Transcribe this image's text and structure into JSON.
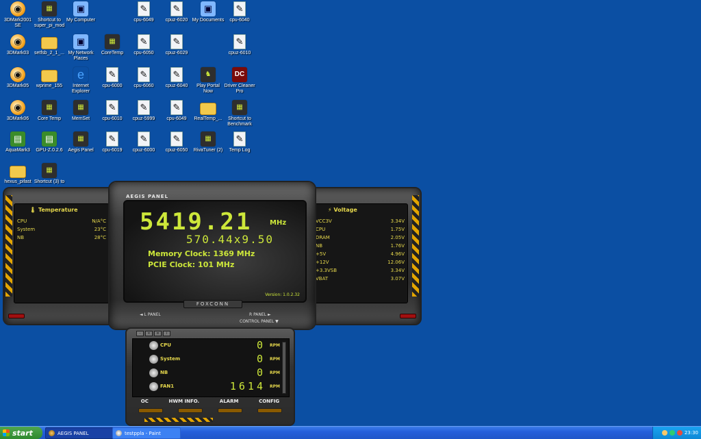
{
  "desktop": {
    "icons": [
      {
        "label": "3DMark2001 SE",
        "icon": "3dmark-icon"
      },
      {
        "label": "Shortcut to super_pi_mod",
        "icon": "superpi-icon"
      },
      {
        "label": "My Computer",
        "icon": "computer-icon"
      },
      {
        "label": "cpu-6049",
        "icon": "image-file-icon"
      },
      {
        "label": "cpuz-6020",
        "icon": "file-icon"
      },
      {
        "label": "My Documents",
        "icon": "documents-icon"
      },
      {
        "label": "cpu-6040",
        "icon": "image-file-icon"
      },
      {
        "label": "3DMark03",
        "icon": "3dmark-icon"
      },
      {
        "label": "setfsb_2_1_...",
        "icon": "folder-icon"
      },
      {
        "label": "My Network Places",
        "icon": "network-icon"
      },
      {
        "label": "CoreTemp",
        "icon": "coretemp-icon"
      },
      {
        "label": "cpu-6050",
        "icon": "image-file-icon"
      },
      {
        "label": "cpuz-6029",
        "icon": "file-icon"
      },
      {
        "label": "cpuz-6010",
        "icon": "file-icon"
      },
      {
        "label": "3DMark05",
        "icon": "3dmark-icon"
      },
      {
        "label": "wprime_155",
        "icon": "folder-icon"
      },
      {
        "label": "Internet Explorer",
        "icon": "ie-icon"
      },
      {
        "label": "cpu-6000",
        "icon": "image-file-icon"
      },
      {
        "label": "cpu-6060",
        "icon": "image-file-icon"
      },
      {
        "label": "cpuz-6040",
        "icon": "file-icon"
      },
      {
        "label": "Play Portal Now",
        "icon": "portal-icon"
      },
      {
        "label": "Driver Cleaner Pro",
        "icon": "driver-cleaner-icon"
      },
      {
        "label": "3DMark06",
        "icon": "3dmark-icon"
      },
      {
        "label": "Core Temp",
        "icon": "coretemp-icon"
      },
      {
        "label": "MemSet",
        "icon": "memset-icon"
      },
      {
        "label": "cpu-6010",
        "icon": "image-file-icon"
      },
      {
        "label": "cpuz-5999",
        "icon": "file-icon"
      },
      {
        "label": "cpu-6049",
        "icon": "image-file-icon"
      },
      {
        "label": "RealTemp_...",
        "icon": "folder-icon"
      },
      {
        "label": "Shortcut to Benchmark",
        "icon": "benchmark-icon"
      },
      {
        "label": "AquaMark3",
        "icon": "aquamark-icon"
      },
      {
        "label": "GPU-Z.0.2.6",
        "icon": "gpuz-icon"
      },
      {
        "label": "Aegis Panel",
        "icon": "aegis-icon"
      },
      {
        "label": "cpu-6019",
        "icon": "image-file-icon"
      },
      {
        "label": "cpuz-6000",
        "icon": "file-icon"
      },
      {
        "label": "cpuz-6050",
        "icon": "file-icon"
      },
      {
        "label": "RivaTuner (2)",
        "icon": "rivatuner-icon"
      },
      {
        "label": "Temp Log",
        "icon": "text-file-icon"
      },
      {
        "label": "hexus_pifast",
        "icon": "folder-icon"
      },
      {
        "label": "Shortcut (3) to",
        "icon": "pll-icon"
      }
    ]
  },
  "aegis": {
    "title": "AEGIS PANEL",
    "temperature": {
      "title": "Temperature",
      "rows": [
        {
          "name": "CPU",
          "value": "N/A°C"
        },
        {
          "name": "System",
          "value": "23°C"
        },
        {
          "name": "NB",
          "value": "28°C"
        }
      ]
    },
    "voltage": {
      "title": "Voltage",
      "rows": [
        {
          "name": "VCC3V",
          "value": "3.34V"
        },
        {
          "name": "CPU",
          "value": "1.75V"
        },
        {
          "name": "DRAM",
          "value": "2.05V"
        },
        {
          "name": "NB",
          "value": "1.76V"
        },
        {
          "name": "+5V",
          "value": "4.96V"
        },
        {
          "name": "+12V",
          "value": "12.06V"
        },
        {
          "name": "+3.3VSB",
          "value": "3.34V"
        },
        {
          "name": "VBAT",
          "value": "3.07V"
        }
      ]
    },
    "display": {
      "clock": "5419.21",
      "clock_unit": "MHz",
      "multiplier": "570.44x9.50",
      "memory": "Memory Clock: 1369 MHz",
      "pcie": "PCIE Clock: 101 MHz",
      "version": "Version: 1.0.2.32"
    },
    "brand": "FOXCONN",
    "nav": {
      "left": "◄ L PANEL",
      "right": "R PANEL ►",
      "control": "CONTROL PANEL ▼"
    },
    "fans": [
      {
        "name": "CPU",
        "value": "0",
        "unit": "RPM"
      },
      {
        "name": "System",
        "value": "0",
        "unit": "RPM"
      },
      {
        "name": "NB",
        "value": "0",
        "unit": "RPM"
      },
      {
        "name": "FAN1",
        "value": "1614",
        "unit": "RPM"
      }
    ],
    "tabs": [
      "OC",
      "HWM INFO.",
      "ALARM",
      "CONFIG"
    ]
  },
  "taskbar": {
    "start": "start",
    "items": [
      {
        "label": "AEGIS PANEL",
        "active": true
      },
      {
        "label": "testppla - Paint",
        "active": false
      }
    ],
    "clock": "23:30"
  }
}
